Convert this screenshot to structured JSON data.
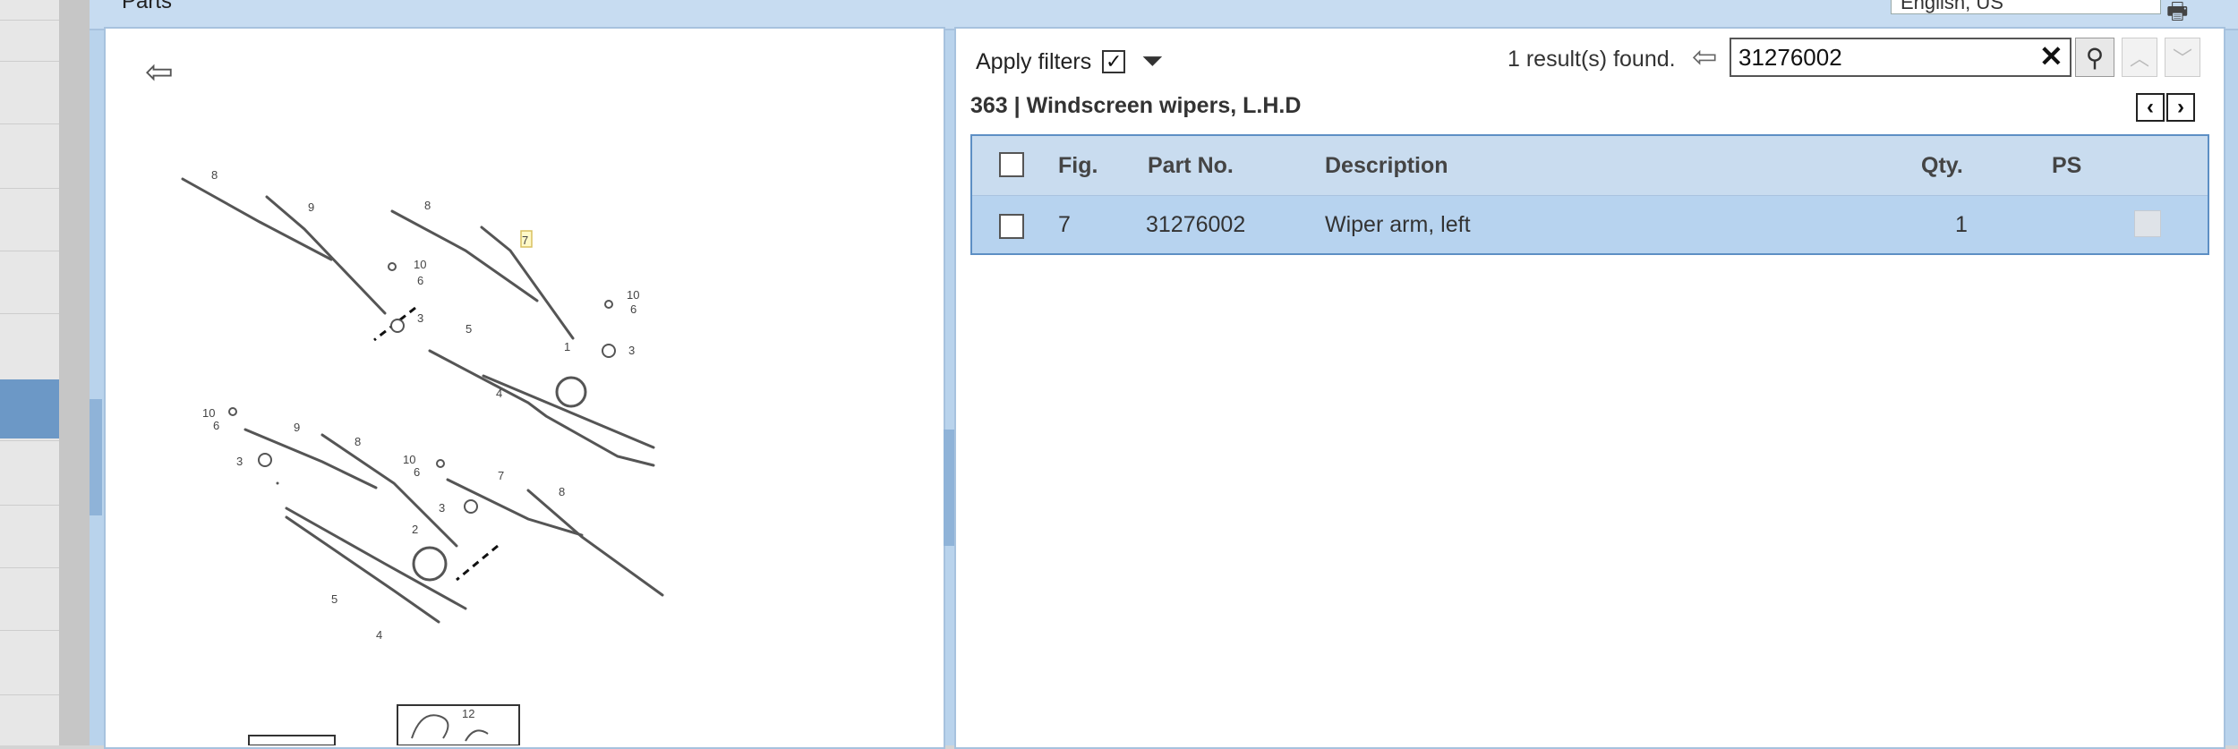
{
  "header": {
    "title": "Parts",
    "language": "English, US"
  },
  "diagram": {
    "labels": [
      "8",
      "9",
      "8",
      "7",
      "10",
      "6",
      "3",
      "10",
      "6",
      "5",
      "1",
      "3",
      "4",
      "10",
      "6",
      "9",
      "8",
      "3",
      "10",
      "6",
      "7",
      "8",
      "3",
      "2",
      "5",
      "4",
      "12"
    ]
  },
  "filters": {
    "apply_label": "Apply filters",
    "checked": true
  },
  "search": {
    "results_text": "1 result(s) found.",
    "value": "31276002"
  },
  "section": {
    "title": "363  |  Windscreen wipers, L.H.D"
  },
  "table": {
    "columns": [
      "Fig.",
      "Part No.",
      "Description",
      "Qty.",
      "PS"
    ],
    "rows": [
      {
        "fig": "7",
        "part_no": "31276002",
        "description": "Wiper arm, left",
        "qty": "1",
        "ps": ""
      }
    ]
  }
}
